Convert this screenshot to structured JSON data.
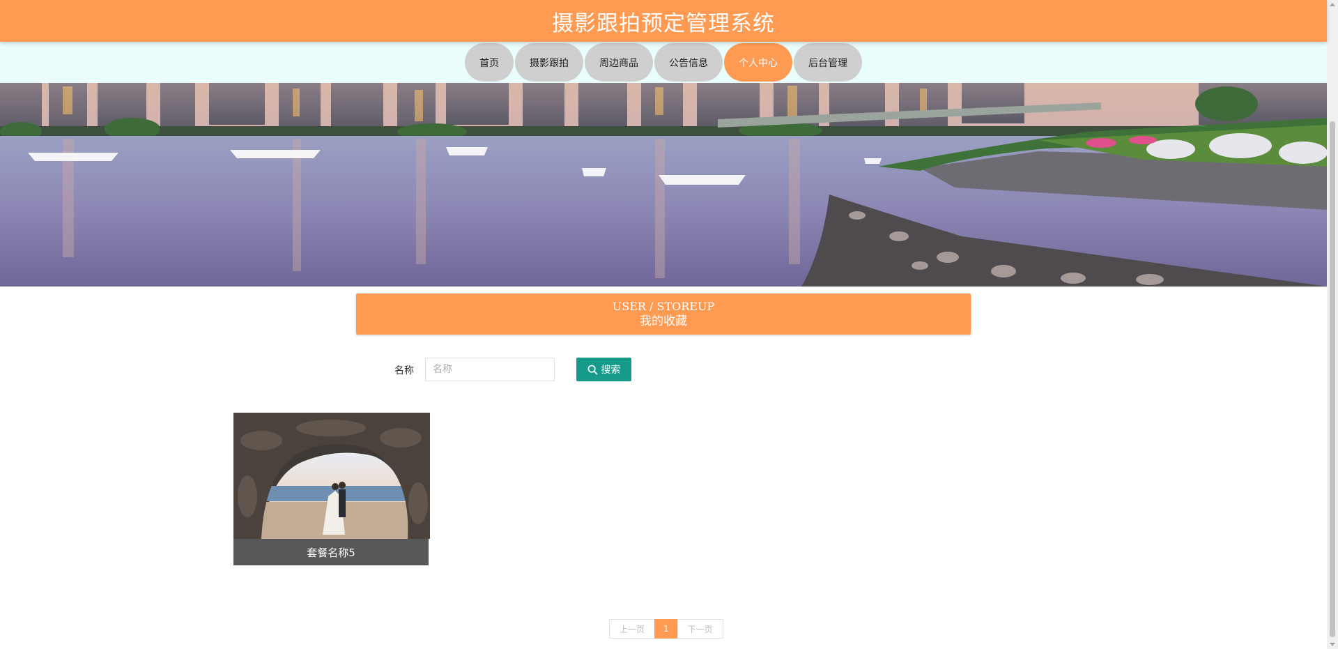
{
  "header": {
    "title": "摄影跟拍预定管理系统"
  },
  "nav": {
    "items": [
      {
        "label": "首页"
      },
      {
        "label": "摄影跟拍"
      },
      {
        "label": "周边商品"
      },
      {
        "label": "公告信息"
      },
      {
        "label": "个人中心",
        "active": true
      },
      {
        "label": "后台管理"
      }
    ]
  },
  "carousel": {
    "slide_count": 3,
    "active_index": 0
  },
  "section": {
    "title_en": "USER / STOREUP",
    "title_cn": "我的收藏"
  },
  "search": {
    "label": "名称",
    "placeholder": "名称",
    "value": "",
    "button_label": "搜索"
  },
  "items": [
    {
      "caption": "套餐名称5"
    }
  ],
  "pagination": {
    "prev_label": "上一页",
    "current_page": "1",
    "next_label": "下一页"
  },
  "colors": {
    "accent": "#ff9a52",
    "nav_background": "#e9fdfd",
    "search_button": "#169b8a",
    "caption_background": "#575757"
  }
}
